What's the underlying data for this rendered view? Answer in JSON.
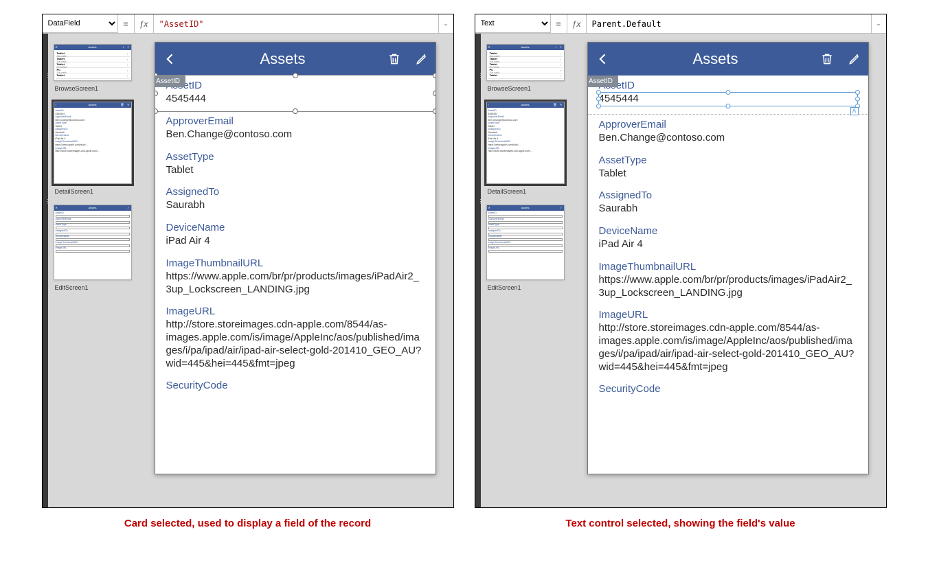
{
  "panel_left": {
    "property": "DataField",
    "formula": "\"AssetID\"",
    "selection_tag": "Card : AssetID",
    "caption": "Card selected, used to display a field of the record"
  },
  "panel_right": {
    "property": "Text",
    "formula": "Parent.Default",
    "selection_tag": "Card : AssetID",
    "caption": "Text control selected, showing the field's value"
  },
  "thumbnails": {
    "browse": "BrowseScreen1",
    "detail": "DetailScreen1",
    "edit": "EditScreen1",
    "items": [
      {
        "title": "Tablet",
        "sub": "Saurabh"
      },
      {
        "title": "Tablet",
        "sub": "Saurabh"
      },
      {
        "title": "Tablet",
        "sub": "Preetika"
      },
      {
        "title": "PC",
        "sub": "Saurabh"
      },
      {
        "title": "Tablet",
        "sub": ""
      }
    ]
  },
  "app": {
    "title": "Assets",
    "fields": [
      {
        "label": "AssetID",
        "value": "4545444"
      },
      {
        "label": "ApproverEmail",
        "value": "Ben.Change@contoso.com"
      },
      {
        "label": "AssetType",
        "value": "Tablet"
      },
      {
        "label": "AssignedTo",
        "value": "Saurabh"
      },
      {
        "label": "DeviceName",
        "value": "iPad Air 4"
      },
      {
        "label": "ImageThumbnailURL",
        "value": "https://www.apple.com/br/pr/products/images/iPadAir2_3up_Lockscreen_LANDING.jpg"
      },
      {
        "label": "ImageURL",
        "value": "http://store.storeimages.cdn-apple.com/8544/as-images.apple.com/is/image/AppleInc/aos/published/images/i/pa/ipad/air/ipad-air-select-gold-201410_GEO_AU?wid=445&hei=445&fmt=jpeg"
      },
      {
        "label": "SecurityCode",
        "value": ""
      }
    ]
  }
}
